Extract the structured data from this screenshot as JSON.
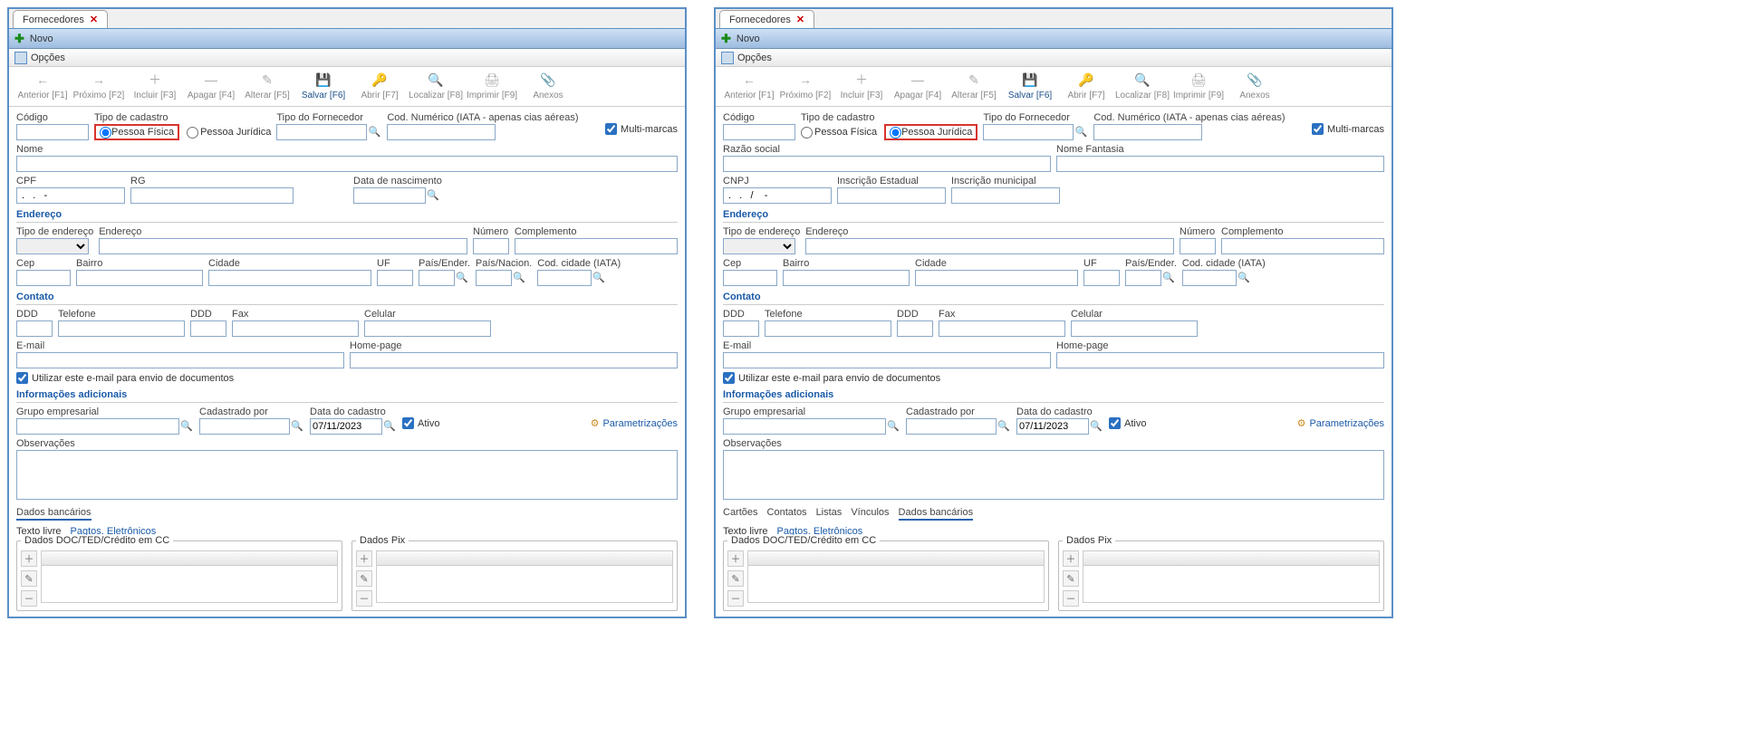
{
  "left": {
    "tab_title": "Fornecedores",
    "sub_tab": "Novo",
    "options_label": "Opções",
    "toolbar": [
      {
        "label": "Anterior [F1]",
        "icon": "←"
      },
      {
        "label": "Próximo [F2]",
        "icon": "→"
      },
      {
        "label": "Incluir [F3]",
        "icon": "＋"
      },
      {
        "label": "Apagar [F4]",
        "icon": "—"
      },
      {
        "label": "Alterar [F5]",
        "icon": "✎"
      },
      {
        "label": "Salvar [F6]",
        "icon": "💾",
        "active": true
      },
      {
        "label": "Abrir [F7]",
        "icon": "🔑"
      },
      {
        "label": "Localizar [F8]",
        "icon": "🔍"
      },
      {
        "label": "Imprimir [F9]",
        "icon": "🖨"
      },
      {
        "label": "Anexos",
        "icon": "📎"
      }
    ],
    "codigo_label": "Código",
    "tipo_cadastro_label": "Tipo de cadastro",
    "pessoa_fisica": "Pessoa Física",
    "pessoa_juridica": "Pessoa Jurídica",
    "tipo_fornecedor_label": "Tipo do Fornecedor",
    "cod_numerico_label": "Cod. Numérico (IATA - apenas cias aéreas)",
    "multi_marcas": "Multi-marcas",
    "nome_label": "Nome",
    "cpf_label": "CPF",
    "cpf_value": " .   .   -",
    "rg_label": "RG",
    "data_nasc_label": "Data de nascimento",
    "endereco_legend": "Endereço",
    "tipo_end_label": "Tipo de endereço",
    "endereco_label": "Endereço",
    "numero_label": "Número",
    "complemento_label": "Complemento",
    "cep_label": "Cep",
    "bairro_label": "Bairro",
    "cidade_label": "Cidade",
    "uf_label": "UF",
    "pais_ender_label": "País/Ender.",
    "pais_nacion_label": "País/Nacion.",
    "cod_cidade_label": "Cod. cidade (IATA)",
    "contato_legend": "Contato",
    "ddd_label": "DDD",
    "telefone_label": "Telefone",
    "fax_label": "Fax",
    "celular_label": "Celular",
    "email_label": "E-mail",
    "homepage_label": "Home-page",
    "utilizar_email": "Utilizar este e-mail para envio de documentos",
    "info_adicionais_legend": "Informações adicionais",
    "grupo_emp_label": "Grupo empresarial",
    "cadastrado_por_label": "Cadastrado por",
    "data_cadastro_label": "Data do cadastro",
    "data_cadastro_value": "07/11/2023",
    "ativo_label": "Ativo",
    "parametrizacoes": "Parametrizações",
    "observacoes_label": "Observações",
    "dados_bancarios_tab": "Dados bancários",
    "texto_livre": "Texto livre",
    "pagtos_eletronicos": "Pagtos. Eletrônicos",
    "dados_doc_label": "Dados DOC/TED/Crédito em CC",
    "dados_pix_label": "Dados Pix"
  },
  "right": {
    "tab_title": "Fornecedores",
    "sub_tab": "Novo",
    "options_label": "Opções",
    "toolbar": [
      {
        "label": "Anterior [F1]",
        "icon": "←"
      },
      {
        "label": "Próximo [F2]",
        "icon": "→"
      },
      {
        "label": "Incluir [F3]",
        "icon": "＋"
      },
      {
        "label": "Apagar [F4]",
        "icon": "—"
      },
      {
        "label": "Alterar [F5]",
        "icon": "✎"
      },
      {
        "label": "Salvar [F6]",
        "icon": "💾",
        "active": true
      },
      {
        "label": "Abrir [F7]",
        "icon": "🔑"
      },
      {
        "label": "Localizar [F8]",
        "icon": "🔍"
      },
      {
        "label": "Imprimir [F9]",
        "icon": "🖨"
      },
      {
        "label": "Anexos",
        "icon": "📎"
      }
    ],
    "codigo_label": "Código",
    "tipo_cadastro_label": "Tipo de cadastro",
    "pessoa_fisica": "Pessoa Física",
    "pessoa_juridica": "Pessoa Jurídica",
    "tipo_fornecedor_label": "Tipo do Fornecedor",
    "cod_numerico_label": "Cod. Numérico (IATA - apenas cias aéreas)",
    "multi_marcas": "Multi-marcas",
    "razao_social_label": "Razão social",
    "nome_fantasia_label": "Nome Fantasia",
    "cnpj_label": "CNPJ",
    "cnpj_value": " .   .   /    -",
    "insc_estadual_label": "Inscrição Estadual",
    "insc_municipal_label": "Inscrição municipal",
    "endereco_legend": "Endereço",
    "tipo_end_label": "Tipo de endereço",
    "endereco_label": "Endereço",
    "numero_label": "Número",
    "complemento_label": "Complemento",
    "cep_label": "Cep",
    "bairro_label": "Bairro",
    "cidade_label": "Cidade",
    "uf_label": "UF",
    "pais_ender_label": "País/Ender.",
    "cod_cidade_label": "Cod. cidade (IATA)",
    "contato_legend": "Contato",
    "ddd_label": "DDD",
    "telefone_label": "Telefone",
    "fax_label": "Fax",
    "celular_label": "Celular",
    "email_label": "E-mail",
    "homepage_label": "Home-page",
    "utilizar_email": "Utilizar este e-mail para envio de documentos",
    "info_adicionais_legend": "Informações adicionais",
    "grupo_emp_label": "Grupo empresarial",
    "cadastrado_por_label": "Cadastrado por",
    "data_cadastro_label": "Data do cadastro",
    "data_cadastro_value": "07/11/2023",
    "ativo_label": "Ativo",
    "parametrizacoes": "Parametrizações",
    "observacoes_label": "Observações",
    "bottom_tabs": [
      "Cartões",
      "Contatos",
      "Listas",
      "Vínculos",
      "Dados bancários"
    ],
    "bottom_selected": "Dados bancários",
    "texto_livre": "Texto livre",
    "pagtos_eletronicos": "Pagtos. Eletrônicos",
    "dados_doc_label": "Dados DOC/TED/Crédito em CC",
    "dados_pix_label": "Dados Pix"
  }
}
